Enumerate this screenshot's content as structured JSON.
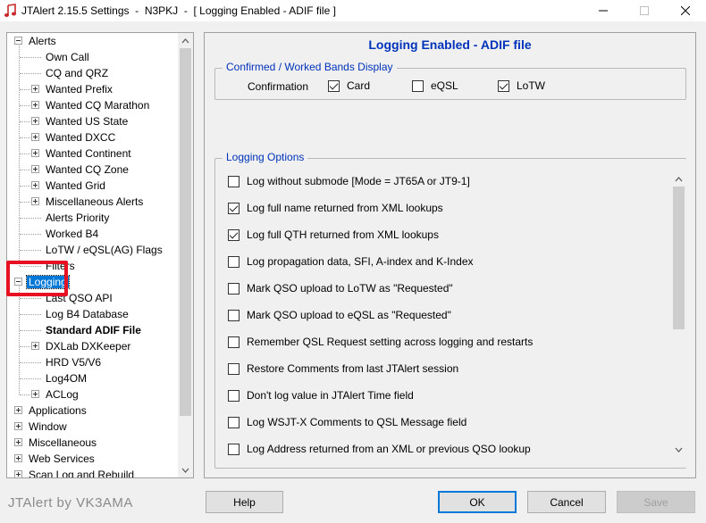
{
  "window": {
    "title": "JTAlert 2.15.5 Settings  -  N3PKJ  -  [ Logging Enabled - ADIF file ]",
    "accent": "#0078d7"
  },
  "tree": {
    "items": [
      {
        "label": "Alerts",
        "level": 0,
        "expander": "minus"
      },
      {
        "label": "Own Call",
        "level": 1,
        "expander": "none"
      },
      {
        "label": "CQ and QRZ",
        "level": 1,
        "expander": "none"
      },
      {
        "label": "Wanted Prefix",
        "level": 1,
        "expander": "plus"
      },
      {
        "label": "Wanted CQ Marathon",
        "level": 1,
        "expander": "plus"
      },
      {
        "label": "Wanted US State",
        "level": 1,
        "expander": "plus"
      },
      {
        "label": "Wanted DXCC",
        "level": 1,
        "expander": "plus"
      },
      {
        "label": "Wanted Continent",
        "level": 1,
        "expander": "plus"
      },
      {
        "label": "Wanted CQ Zone",
        "level": 1,
        "expander": "plus"
      },
      {
        "label": "Wanted Grid",
        "level": 1,
        "expander": "plus"
      },
      {
        "label": "Miscellaneous Alerts",
        "level": 1,
        "expander": "plus"
      },
      {
        "label": "Alerts Priority",
        "level": 1,
        "expander": "none"
      },
      {
        "label": "Worked B4",
        "level": 1,
        "expander": "none"
      },
      {
        "label": "LoTW / eQSL(AG) Flags",
        "level": 1,
        "expander": "none"
      },
      {
        "label": "Filters",
        "level": 1,
        "expander": "none"
      },
      {
        "label": "Logging",
        "level": 0,
        "expander": "minus",
        "selected": true
      },
      {
        "label": "Last QSO API",
        "level": 1,
        "expander": "none"
      },
      {
        "label": "Log B4 Database",
        "level": 1,
        "expander": "none"
      },
      {
        "label": "Standard ADIF File",
        "level": 1,
        "expander": "none",
        "bold": true
      },
      {
        "label": "DXLab DXKeeper",
        "level": 1,
        "expander": "plus"
      },
      {
        "label": "HRD V5/V6",
        "level": 1,
        "expander": "none"
      },
      {
        "label": "Log4OM",
        "level": 1,
        "expander": "none"
      },
      {
        "label": "ACLog",
        "level": 1,
        "expander": "plus"
      },
      {
        "label": "Applications",
        "level": 0,
        "expander": "plus"
      },
      {
        "label": "Window",
        "level": 0,
        "expander": "plus"
      },
      {
        "label": "Miscellaneous",
        "level": 0,
        "expander": "plus"
      },
      {
        "label": "Web Services",
        "level": 0,
        "expander": "plus"
      },
      {
        "label": "Scan Log and Rebuild",
        "level": 0,
        "expander": "plus"
      }
    ]
  },
  "panel": {
    "title": "Logging Enabled - ADIF file",
    "confirmed_group": {
      "legend": "Confirmed / Worked Bands Display",
      "confirmation_label": "Confirmation",
      "options": [
        {
          "label": "Card",
          "checked": true
        },
        {
          "label": "eQSL",
          "checked": false
        },
        {
          "label": "LoTW",
          "checked": true
        }
      ]
    },
    "logging_group": {
      "legend": "Logging Options",
      "options": [
        {
          "label": "Log without submode [Mode = JT65A or JT9-1]",
          "checked": false
        },
        {
          "label": "Log full name returned from XML lookups",
          "checked": true
        },
        {
          "label": "Log full QTH returned from XML lookups",
          "checked": true
        },
        {
          "label": "Log propagation data, SFI, A-index and K-Index",
          "checked": false
        },
        {
          "label": "Mark QSO upload to LoTW as \"Requested\"",
          "checked": false
        },
        {
          "label": "Mark QSO upload to eQSL as \"Requested\"",
          "checked": false
        },
        {
          "label": "Remember QSL Request setting across logging and restarts",
          "checked": false
        },
        {
          "label": "Restore Comments from last JTAlert session",
          "checked": false
        },
        {
          "label": "Don't log value in JTAlert Time field",
          "checked": false
        },
        {
          "label": "Log WSJT-X Comments to QSL Message field",
          "checked": false
        },
        {
          "label": "Log Address returned from an XML or previous QSO lookup",
          "checked": false
        }
      ]
    }
  },
  "footer": {
    "brand": "JTAlert by VK3AMA",
    "help": "Help",
    "ok": "OK",
    "cancel": "Cancel",
    "save": "Save"
  }
}
